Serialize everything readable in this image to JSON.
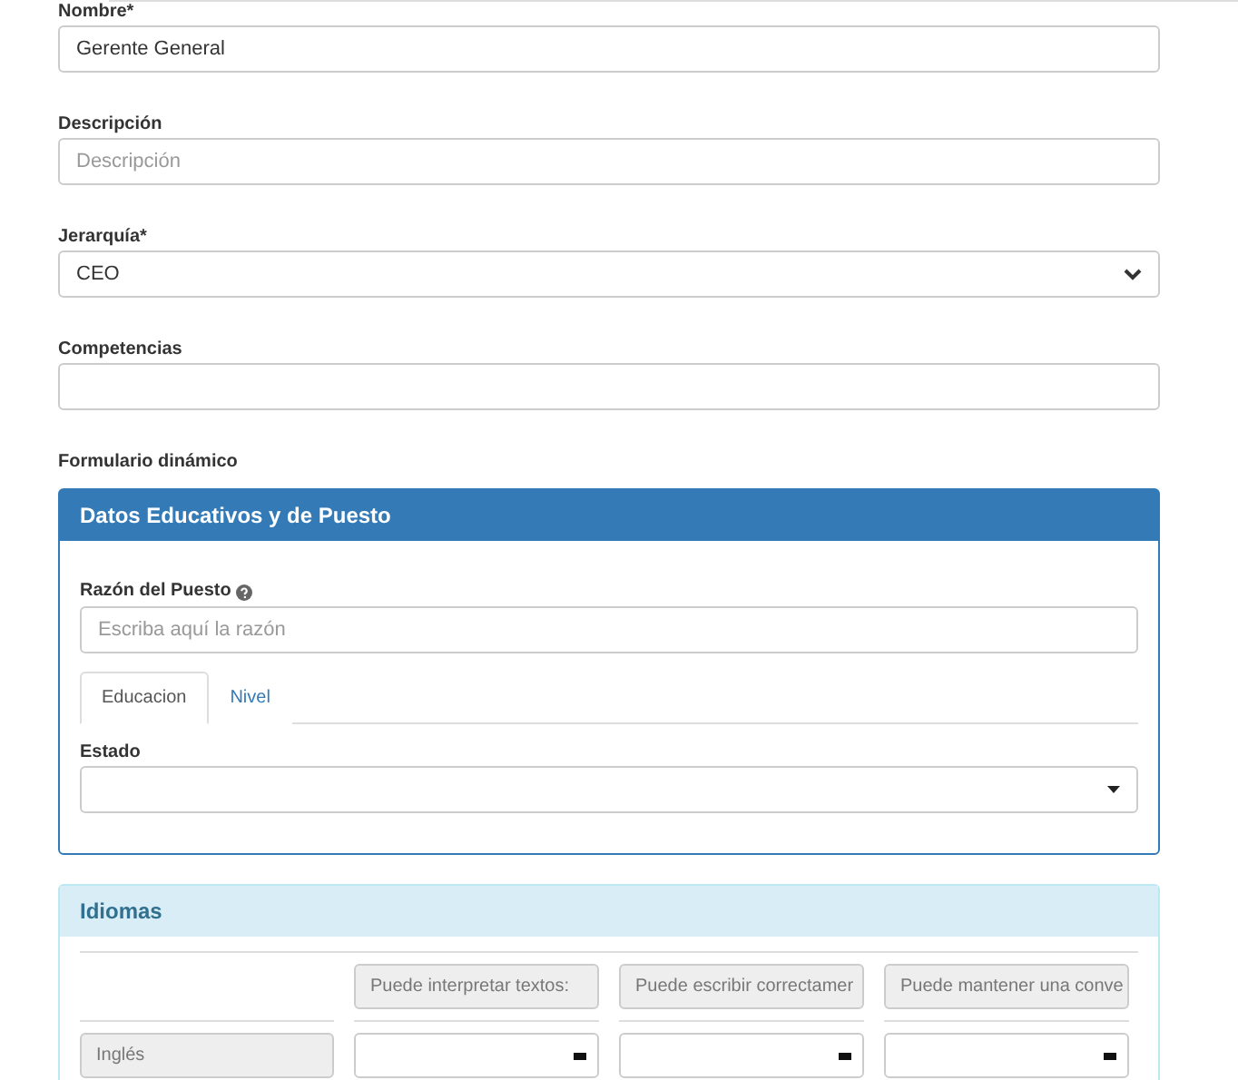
{
  "fields": [
    {
      "kind": "text",
      "label": "Nombre*",
      "value": "Gerente General"
    },
    {
      "kind": "text",
      "label": "Descripción",
      "placeholder": "Descripción"
    },
    {
      "kind": "select",
      "label": "Jerarquía*",
      "value": "CEO"
    },
    {
      "kind": "text",
      "label": "Competencias"
    }
  ],
  "dynamic_form_label": "Formulario dinámico",
  "education_panel": {
    "title": "Datos Educativos y de Puesto",
    "reason": {
      "label": "Razón del Puesto",
      "placeholder": "Escriba aquí la razón"
    },
    "tabs": [
      {
        "label": "Educacion",
        "selected": true
      },
      {
        "label": "Nivel",
        "selected": false
      }
    ],
    "status": {
      "label": "Estado"
    }
  },
  "languages_panel": {
    "title": "Idiomas",
    "columns": [
      "Puede interpretar textos:",
      "Puede escribir correctamer",
      "Puede mantener una conve"
    ],
    "rows": [
      {
        "language": "Inglés"
      }
    ]
  }
}
